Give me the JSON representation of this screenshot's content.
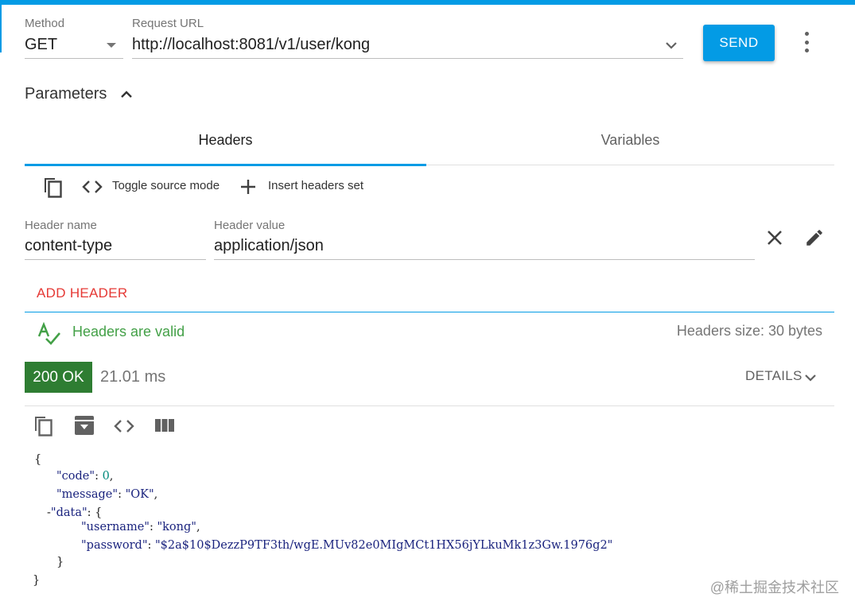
{
  "request": {
    "method_label": "Method",
    "method_value": "GET",
    "url_label": "Request URL",
    "url_value": "http://localhost:8081/v1/user/kong",
    "send_label": "SEND"
  },
  "parameters": {
    "title": "Parameters",
    "tabs": [
      {
        "label": "Headers",
        "active": true
      },
      {
        "label": "Variables",
        "active": false
      }
    ],
    "toolbar": {
      "toggle_source_label": "Toggle source mode",
      "insert_headers_label": "Insert headers set"
    },
    "header_row": {
      "name_label": "Header name",
      "name_value": "content-type",
      "value_label": "Header value",
      "value_value": "application/json"
    },
    "add_header_label": "ADD HEADER",
    "validation_text": "Headers are valid",
    "size_text": "Headers size: 30 bytes"
  },
  "response": {
    "status": "200 OK",
    "time": "21.01 ms",
    "details_label": "DETAILS",
    "json": {
      "open_brace": "{",
      "code_key": "\"code\"",
      "code_value": "0",
      "message_key": "\"message\"",
      "message_value": "\"OK\"",
      "data_key": "\"data\"",
      "username_key": "\"username\"",
      "username_value": "\"kong\"",
      "password_key": "\"password\"",
      "password_value": "\"$2a$10$DezzP9TF3th/wgE.MUv82e0MIgMCt1HX56jYLkuMk1z3Gw.1976g2\"",
      "inner_close": "}",
      "close_brace": "}"
    }
  },
  "watermark": "@稀土掘金技术社区",
  "colors": {
    "accent": "#039be5",
    "success": "#2e7d32",
    "valid_text": "#43a047",
    "add_header": "#e53935"
  }
}
